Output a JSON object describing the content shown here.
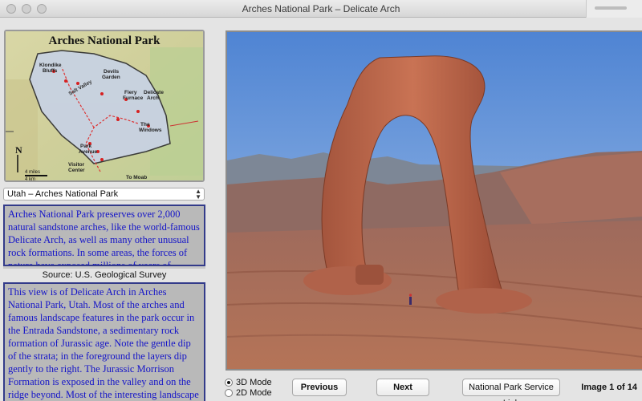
{
  "window": {
    "title": "Arches National Park – Delicate Arch"
  },
  "map": {
    "title": "Arches National Park",
    "labels": [
      "Klondike Bluffs",
      "Devils Garden",
      "Salt Valley",
      "Fiery Furnace",
      "Delicate Arch",
      "The Windows",
      "Park Avenue",
      "Visitor Center",
      "To Moab",
      "N",
      "4 miles",
      "4 km"
    ]
  },
  "selector": {
    "selected": "Utah – Arches National Park"
  },
  "description": "Arches National Park preserves over 2,000 natural sandstone arches, like the world-famous Delicate Arch, as well as many other unusual rock formations. In some areas, the forces of nature have exposed millions of years of geologic history.",
  "source": "Source: U.S. Geological Survey",
  "caption": "This view is of Delicate Arch in Arches National Park, Utah. Most of the arches and famous landscape features in the park occur in the Entrada Sandstone, a sedimentary rock formation of Jurassic age. Note the gentle dip of the strata; in the foreground the layers dip gently to the right. The Jurassic Morrison Formation is exposed in the valley and on the ridge beyond. Most of the interesting landscape features are associated with the erosion of the gentle structure of the Salt Creek",
  "modes": {
    "mode3d": "3D Mode",
    "mode2d": "2D Mode"
  },
  "buttons": {
    "previous": "Previous",
    "next": "Next",
    "link": "National Park Service Link"
  },
  "image_counter": "Image 1 of 14"
}
